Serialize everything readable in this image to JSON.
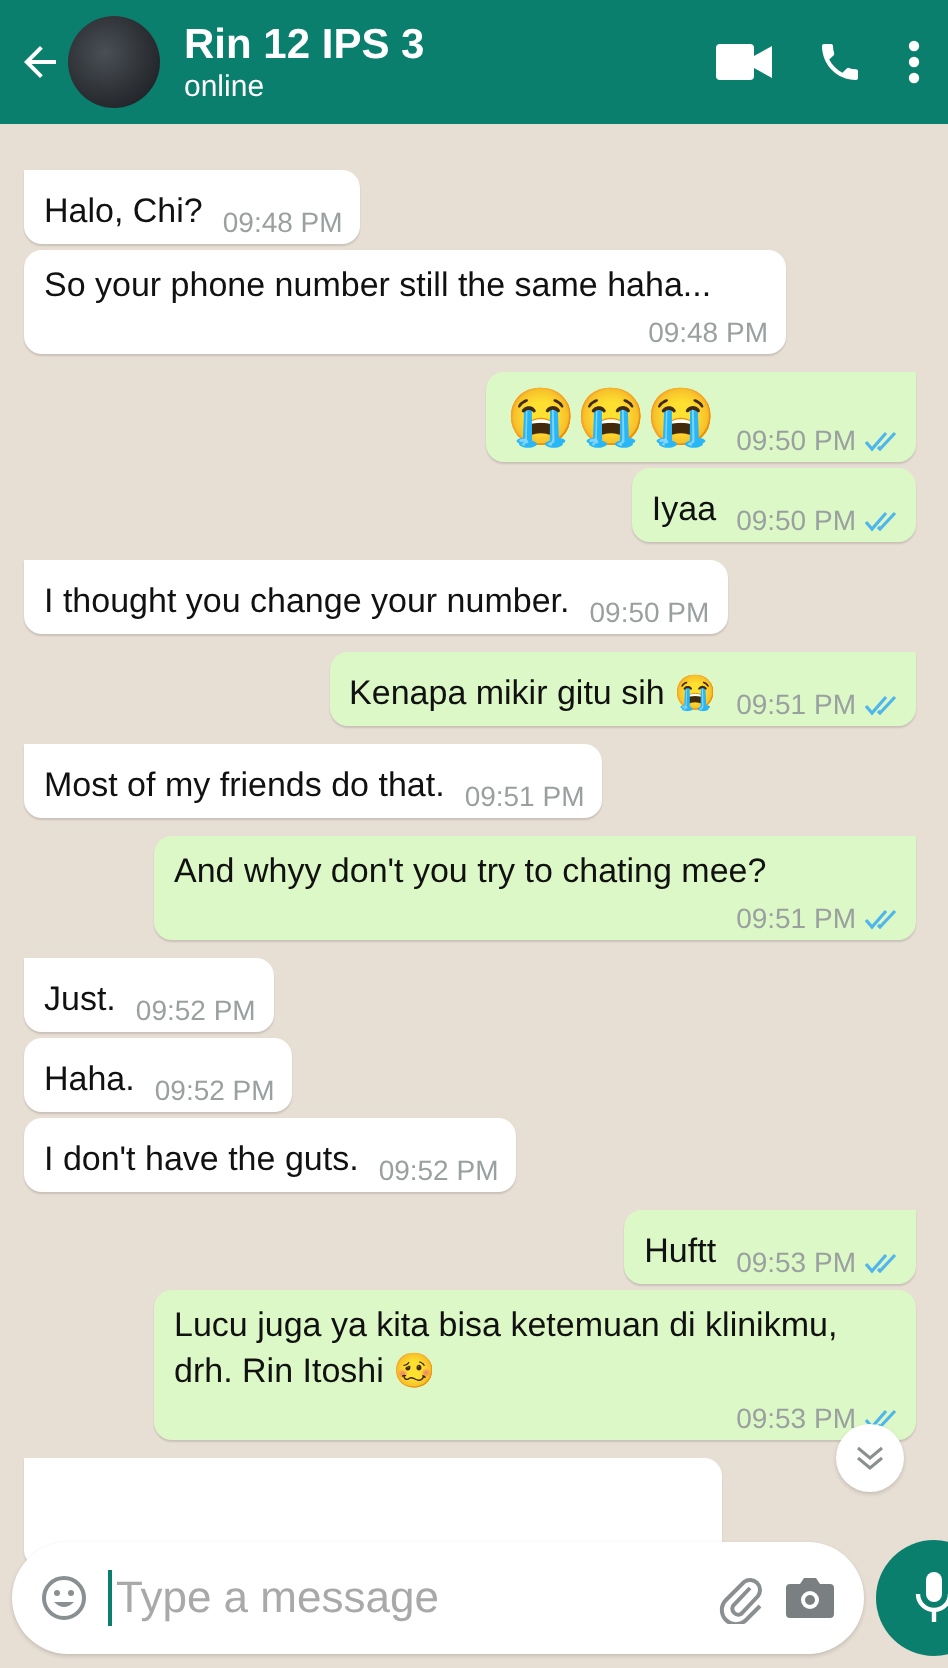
{
  "header": {
    "title": "Rin 12 IPS 3",
    "status": "online"
  },
  "messages": [
    {
      "kind": "in",
      "tail": true,
      "text": "Halo, Chi?",
      "time": "09:48 PM"
    },
    {
      "kind": "in",
      "tail": false,
      "text": "So your phone number still the same haha...",
      "time": "09:48 PM"
    },
    {
      "kind": "out",
      "tail": true,
      "text": "😭😭😭",
      "time": "09:50 PM",
      "read": true,
      "emoji_only": true
    },
    {
      "kind": "out",
      "tail": false,
      "text": "Iyaa",
      "time": "09:50 PM",
      "read": true
    },
    {
      "kind": "in",
      "tail": true,
      "text": "I thought you change your number.",
      "time": "09:50 PM"
    },
    {
      "kind": "out",
      "tail": true,
      "text": "Kenapa mikir gitu sih 😭",
      "time": "09:51 PM",
      "read": true
    },
    {
      "kind": "in",
      "tail": true,
      "text": "Most of my friends do that.",
      "time": "09:51 PM"
    },
    {
      "kind": "out",
      "tail": true,
      "text": "And whyy don't you try to chating mee?",
      "time": "09:51 PM",
      "read": true
    },
    {
      "kind": "in",
      "tail": true,
      "text": "Just.",
      "time": "09:52 PM"
    },
    {
      "kind": "in",
      "tail": false,
      "text": "Haha.",
      "time": "09:52 PM"
    },
    {
      "kind": "in",
      "tail": false,
      "text": "I don't have the guts.",
      "time": "09:52 PM"
    },
    {
      "kind": "out",
      "tail": true,
      "text": "Huftt",
      "time": "09:53 PM",
      "read": true
    },
    {
      "kind": "out",
      "tail": false,
      "text": "Lucu juga ya kita bisa ketemuan di klinikmu, drh. Rin Itoshi 🥴",
      "time": "09:53 PM",
      "read": true
    },
    {
      "kind": "in",
      "tail": true
    }
  ],
  "composer": {
    "placeholder": "Type a message"
  }
}
